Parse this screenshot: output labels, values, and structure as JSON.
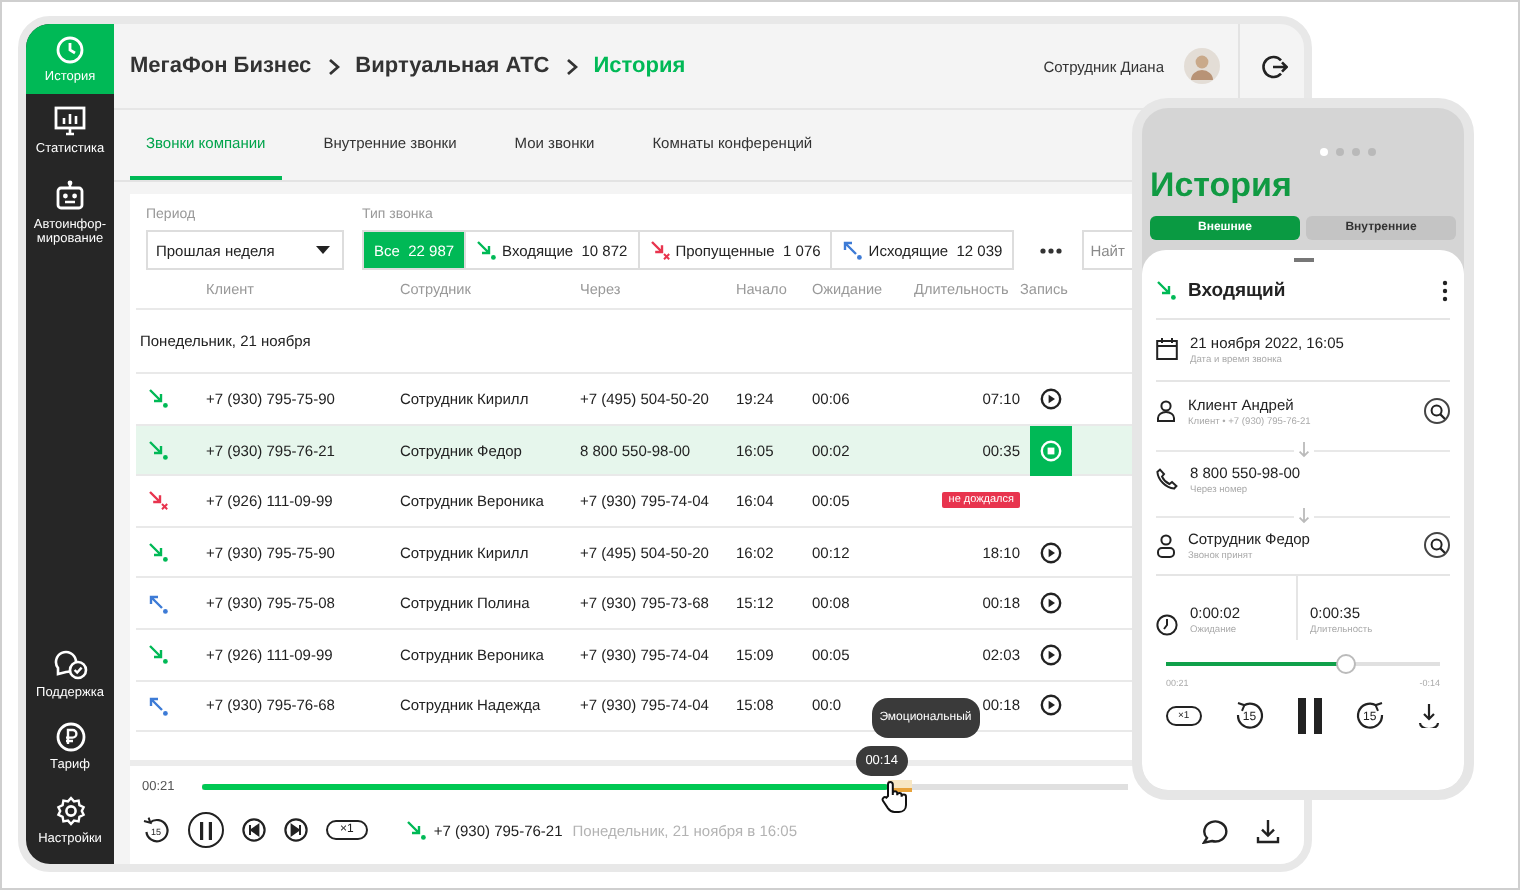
{
  "sidebar": {
    "top_items": [
      {
        "label": "История",
        "selected": true
      },
      {
        "label": "Статистика",
        "selected": false
      },
      {
        "label": "Автоинфор-мирование",
        "selected": false
      }
    ],
    "bottom_items": [
      {
        "label": "Поддержка",
        "selected": false
      },
      {
        "label": "Тариф",
        "selected": false
      },
      {
        "label": "Настройки",
        "selected": false
      }
    ]
  },
  "breadcrumb": [
    {
      "label": "МегаФон Бизнес",
      "current": false
    },
    {
      "label": "Виртуальная АТС",
      "current": false
    },
    {
      "label": "История",
      "current": true
    }
  ],
  "user": {
    "name": "Сотрудник Диана"
  },
  "tabs": [
    {
      "label": "Звонки компании",
      "selected": true
    },
    {
      "label": "Внутренние звонки",
      "selected": false
    },
    {
      "label": "Мои звонки",
      "selected": false
    },
    {
      "label": "Комнаты конференций",
      "selected": false
    }
  ],
  "filters": {
    "period": {
      "label": "Период",
      "value": "Прошлая неделя"
    },
    "call_type": {
      "label": "Тип звонка",
      "options": [
        {
          "kind": "all",
          "label": "Все",
          "count": "22 987",
          "selected": true
        },
        {
          "kind": "incoming",
          "label": "Входящие",
          "count": "10 872",
          "selected": false
        },
        {
          "kind": "missed",
          "label": "Пропущенные",
          "count": "1 076",
          "selected": false
        },
        {
          "kind": "outgoing",
          "label": "Исходящие",
          "count": "12 039",
          "selected": false
        }
      ]
    },
    "search": {
      "placeholder": "Найт"
    }
  },
  "table": {
    "columns": [
      "Клиент",
      "Сотрудник",
      "Через",
      "Начало",
      "Ожидание",
      "Длительность",
      "Запись"
    ],
    "group": "Понедельник, 21 ноября",
    "rows": [
      {
        "kind": "incoming",
        "client": "+7 (930) 795-75-90",
        "employee": "Сотрудник Кирилл",
        "via": "+7 (495) 504-50-20",
        "start": "19:24",
        "wait": "00:06",
        "duration": "07:10",
        "selected": false
      },
      {
        "kind": "incoming",
        "client": "+7 (930) 795-76-21",
        "employee": "Сотрудник Федор",
        "via": "8 800 550-98-00",
        "start": "16:05",
        "wait": "00:02",
        "duration": "00:35",
        "selected": true
      },
      {
        "kind": "missed",
        "client": "+7 (926) 111-09-99",
        "employee": "Сотрудник Вероника",
        "via": "+7 (930) 795-74-04",
        "start": "16:04",
        "wait": "00:05",
        "status": "не дождался",
        "selected": false
      },
      {
        "kind": "incoming",
        "client": "+7 (930) 795-75-90",
        "employee": "Сотрудник Кирилл",
        "via": "+7 (495) 504-50-20",
        "start": "16:02",
        "wait": "00:12",
        "duration": "18:10",
        "selected": false
      },
      {
        "kind": "outgoing",
        "client": "+7 (930) 795-75-08",
        "employee": "Сотрудник Полина",
        "via": "+7 (930) 795-73-68",
        "start": "15:12",
        "wait": "00:08",
        "duration": "00:18",
        "selected": false
      },
      {
        "kind": "incoming",
        "client": "+7 (926) 111-09-99",
        "employee": "Сотрудник Вероника",
        "via": "+7 (930) 795-74-04",
        "start": "15:09",
        "wait": "00:05",
        "duration": "02:03",
        "selected": false
      },
      {
        "kind": "outgoing",
        "client": "+7 (930) 795-76-68",
        "employee": "Сотрудник Надежда",
        "via": "+7 (930) 795-74-04",
        "start": "15:08",
        "wait": "00:0",
        "duration": "00:18",
        "selected": false
      }
    ]
  },
  "player": {
    "time": "00:21",
    "level": 0.74,
    "marker": {
      "label": "Эмоциональный",
      "time": "00:14"
    },
    "skip": "15",
    "speed": "×1",
    "call": {
      "kind": "incoming",
      "phone": "+7 (930) 795-76-21",
      "date": "Понедельник, 21 ноября в 16:05"
    }
  },
  "phone": {
    "pager": [
      {
        "selected": true
      },
      {
        "selected": false
      },
      {
        "selected": false
      },
      {
        "selected": false
      }
    ],
    "title": "История",
    "segments": [
      {
        "label": "Внешние",
        "selected": true
      },
      {
        "label": "Внутренние",
        "selected": false
      }
    ],
    "card": {
      "kind": "incoming",
      "title": "Входящий",
      "details": [
        {
          "kind": "date",
          "value": "21 ноября 2022, 16:05",
          "caption": "Дата и время звонка"
        },
        {
          "kind": "client",
          "value": "Клиент Андрей",
          "caption": "Клиент • +7 (930) 795-76-21"
        },
        {
          "kind": "via",
          "value": "8 800 550-98-00",
          "caption": "Через номер"
        },
        {
          "kind": "employee",
          "value": "Сотрудник Федор",
          "caption": "Звонок принят"
        }
      ],
      "wait": {
        "value": "0:00:02",
        "caption": "Ожидание"
      },
      "duration": {
        "value": "0:00:35",
        "caption": "Длительность"
      },
      "player": {
        "level": 0.66,
        "elapsed": "00:21",
        "remaining": "-0:14",
        "speed": "×1",
        "back": "15",
        "forward": "15"
      }
    }
  }
}
